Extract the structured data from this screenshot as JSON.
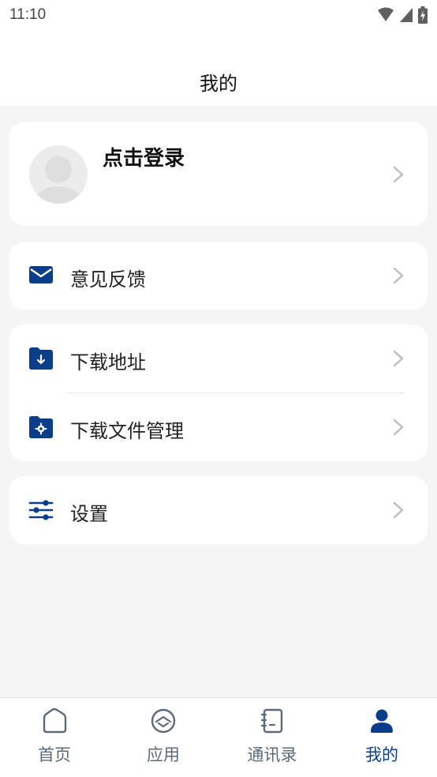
{
  "status_bar": {
    "time": "11:10"
  },
  "header": {
    "title": "我的"
  },
  "profile": {
    "login_label": "点击登录"
  },
  "menu": {
    "feedback": "意见反馈",
    "download_address": "下载地址",
    "download_file_manage": "下载文件管理",
    "settings": "设置"
  },
  "tabs": [
    {
      "label": "首页",
      "icon": "home-icon"
    },
    {
      "label": "应用",
      "icon": "apps-icon"
    },
    {
      "label": "通讯录",
      "icon": "contacts-icon"
    },
    {
      "label": "我的",
      "icon": "person-icon"
    }
  ],
  "colors": {
    "accent": "#0a3d8a",
    "inactive": "#5d6a78",
    "background": "#f5f5f5"
  }
}
